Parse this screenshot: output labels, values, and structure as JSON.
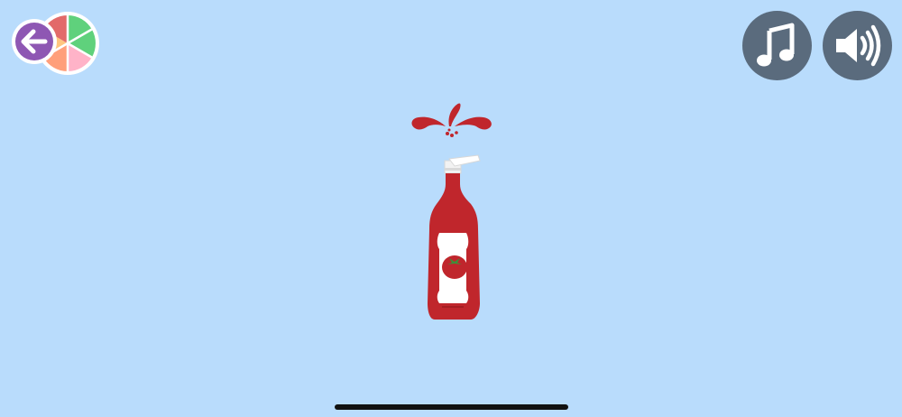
{
  "screen": {
    "background": "#b9dcfc"
  },
  "top_left": {
    "back_icon": "arrow-left-icon",
    "back_color": "#8e57b3",
    "wheel_icon": "color-wheel-icon",
    "wheel_colors": [
      "#e26a6a",
      "#5fd17c",
      "#ffb3c8",
      "#ff9f7a",
      "#ffc680",
      "#9fd9f5"
    ]
  },
  "top_right": {
    "music_icon": "music-note-icon",
    "sound_icon": "speaker-volume-icon",
    "button_color": "#5a6b7d"
  },
  "scene": {
    "object_icon": "ketchup-bottle-icon",
    "label_icon": "tomato-icon",
    "splash_icon": "ketchup-splash-icon",
    "ketchup_color": "#c0262c"
  },
  "system": {
    "home_indicator": "home-indicator"
  }
}
